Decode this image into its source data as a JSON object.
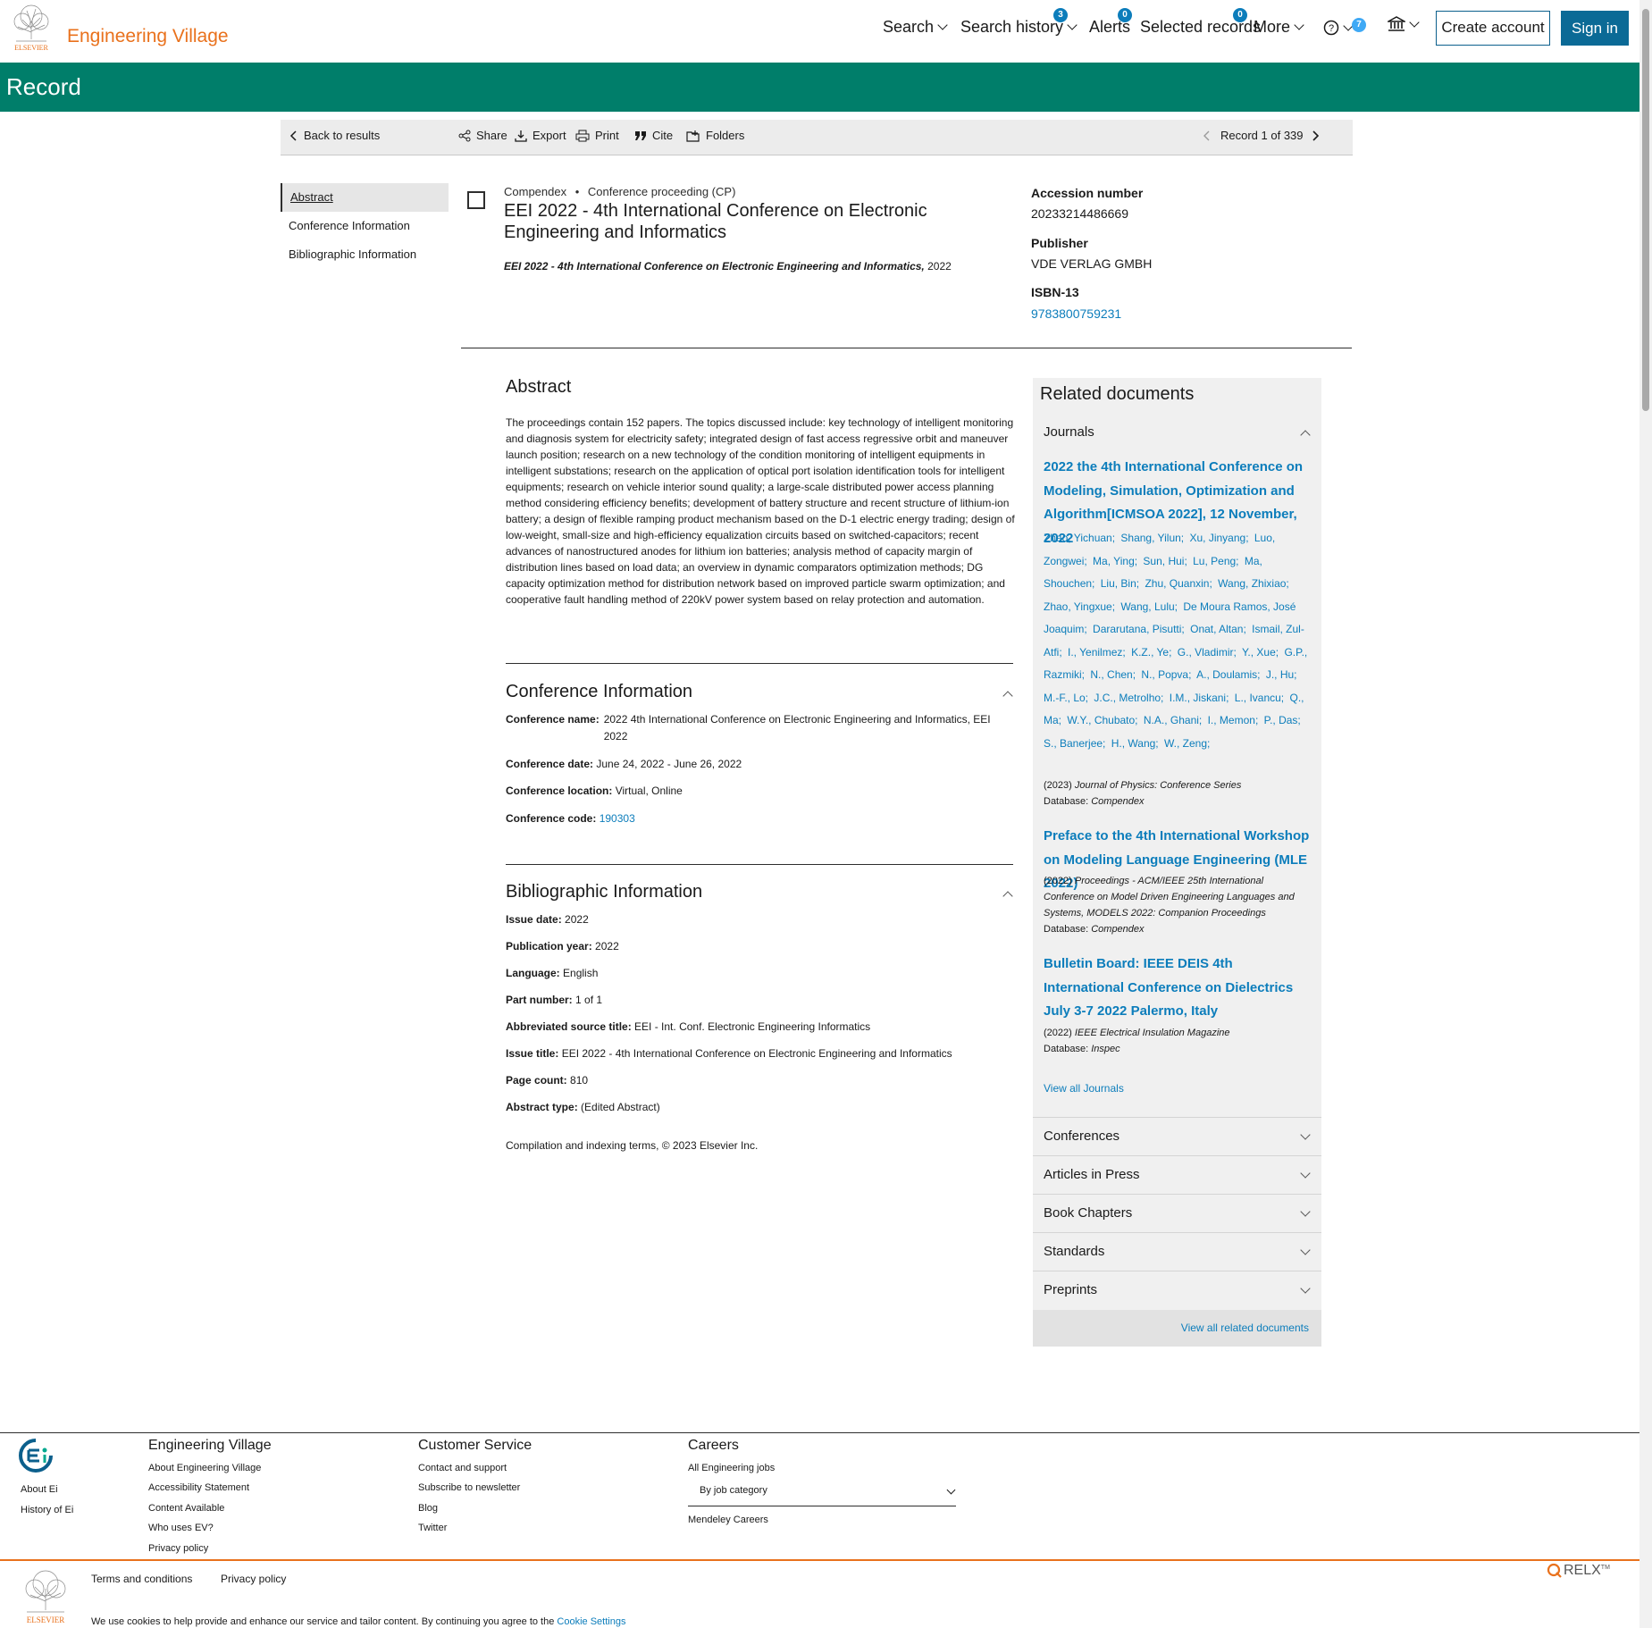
{
  "header": {
    "brand": "Engineering Village",
    "logo_text": "ELSEVIER",
    "nav": {
      "search": "Search",
      "search_history": "Search history",
      "search_history_count": "3",
      "alerts": "Alerts",
      "alerts_count": "0",
      "selected_records": "Selected records",
      "selected_count": "0",
      "more": "More",
      "help_count": "7"
    },
    "create_account": "Create account",
    "sign_in": "Sign in"
  },
  "banner": {
    "title": "Record"
  },
  "toolbar": {
    "back": "Back to results",
    "share": "Share",
    "export": "Export",
    "print": "Print",
    "cite": "Cite",
    "folders": "Folders",
    "record_position": "Record 1 of 339"
  },
  "leftnav": [
    "Abstract",
    "Conference Information",
    "Bibliographic Information"
  ],
  "record": {
    "database": "Compendex",
    "doc_type": "Conference proceeding (CP)",
    "title": "EEI 2022 - 4th International Conference on Electronic Engineering and Informatics",
    "source_title": "EEI 2022 - 4th International Conference on Electronic Engineering and Informatics,",
    "source_year": "2022",
    "accession_label": "Accession number",
    "accession": "20233214486669",
    "publisher_label": "Publisher",
    "publisher": "VDE VERLAG GMBH",
    "isbn_label": "ISBN-13",
    "isbn": "9783800759231"
  },
  "abstract": {
    "heading": "Abstract",
    "text": "The proceedings contain 152 papers. The topics discussed include: key technology of intelligent monitoring and diagnosis system for electricity safety; integrated design of fast access regressive orbit and maneuver launch position; research on a new technology of the condition monitoring of intelligent equipments in intelligent substations; research on the application of optical port isolation identification tools for intelligent equipments; research on vehicle interior sound quality; a large-scale distributed power access planning method considering efficiency benefits; development of battery structure and recent structure of lithium-ion battery; a design of flexible ramping product mechanism based on the D-1 electric energy trading; design of low-weight, small-size and high-efficiency equalization circuits based on switched-capacitors; recent advances of nanostructured anodes for lithium ion batteries; analysis method of capacity margin of distribution lines based on load data; an overview in dynamic comparators optimization methods; DG capacity optimization method for distribution network based on improved particle swarm optimization; and cooperative fault handling method of 220kV power system based on relay protection and automation."
  },
  "conference": {
    "heading": "Conference Information",
    "name_label": "Conference name:",
    "name": "2022 4th International Conference on Electronic Engineering and Informatics, EEI 2022",
    "date_label": "Conference date:",
    "date": "June 24, 2022 - June 26, 2022",
    "location_label": "Conference location:",
    "location": "Virtual, Online",
    "code_label": "Conference code:",
    "code": "190303"
  },
  "bibliographic": {
    "heading": "Bibliographic Information",
    "fields": [
      {
        "label": "Issue date:",
        "value": "2022"
      },
      {
        "label": "Publication year:",
        "value": "2022"
      },
      {
        "label": "Language:",
        "value": "English"
      },
      {
        "label": "Part number:",
        "value": "1 of 1"
      },
      {
        "label": "Abbreviated source title:",
        "value": "EEI - Int. Conf. Electronic Engineering Informatics"
      },
      {
        "label": "Issue title:",
        "value": "EEI 2022 - 4th International Conference on Electronic Engineering and Informatics"
      },
      {
        "label": "Page count:",
        "value": "810"
      },
      {
        "label": "Abstract type:",
        "value": "(Edited Abstract)"
      }
    ],
    "copyright": "Compilation and indexing terms, © 2023 Elsevier Inc."
  },
  "related": {
    "heading": "Related documents",
    "journals_label": "Journals",
    "doc1": {
      "title": "2022 the 4th International Conference on Modeling, Simulation, Optimization and Algorithm[ICMSOA 2022], 12 November, 2022",
      "authors": [
        "Zhao, Yichuan;",
        "Shang, Yilun;",
        "Xu, Jinyang;",
        "Luo, Zongwei;",
        "Ma, Ying;",
        "Sun, Hui;",
        "Lu, Peng;",
        "Ma, Shouchen;",
        "Liu, Bin;",
        "Zhu, Quanxin;",
        "Wang, Zhixiao;",
        "Zhao, Yingxue;",
        "Wang, Lulu;",
        "De Moura Ramos, José Joaquim;",
        "Dararutana, Pisutti;",
        "Onat, Altan;",
        "Ismail, Zul-Atfi;",
        "I., Yenilmez;",
        "K.Z., Ye;",
        "G., Vladimir;",
        "Y., Xue;",
        "G.P., Razmiki;",
        "N., Chen;",
        "N., Popva;",
        "A., Doulamis;",
        "J., Hu;",
        "M.-F., Lo;",
        "J.C., Metrolho;",
        "I.M., Jiskani;",
        "L., Ivancu;",
        "Q., Ma;",
        "W.Y., Chubato;",
        "N.A., Ghani;",
        "I., Memon;",
        "P., Das;",
        "S., Banerjee;",
        "H., Wang;",
        "W., Zeng;"
      ],
      "year": "(2023)",
      "journal": "Journal of Physics: Conference Series",
      "db_label": "Database:",
      "db": "Compendex"
    },
    "doc2": {
      "title": "Preface to the 4th International Workshop on Modeling Language Engineering (MLE 2022)",
      "year": "(2022)",
      "journal": "Proceedings - ACM/IEEE 25th International Conference on Model Driven Engineering Languages and Systems, MODELS 2022: Companion Proceedings",
      "db_label": "Database:",
      "db": "Compendex"
    },
    "doc3": {
      "title": "Bulletin Board: IEEE DEIS 4th International Conference on Dielectrics July 3-7 2022 Palermo, Italy",
      "year": "(2022)",
      "journal": "IEEE Electrical Insulation Magazine",
      "db_label": "Database:",
      "db": "Inspec"
    },
    "view_all_journals": "View all Journals",
    "sections": [
      "Conferences",
      "Articles in Press",
      "Book Chapters",
      "Standards",
      "Preprints"
    ],
    "view_all_related": "View all related documents"
  },
  "footer": {
    "about_ei": "About Ei",
    "history_ei": "History of Ei",
    "col1_heading": "Engineering Village",
    "col1_links": [
      "About Engineering Village",
      "Accessibility Statement",
      "Content Available",
      "Who uses EV?",
      "Privacy policy"
    ],
    "col2_heading": "Customer Service",
    "col2_links": [
      "Contact and support",
      "Subscribe to newsletter",
      "Blog",
      "Twitter"
    ],
    "col3_heading": "Careers",
    "col3_link": "All Engineering jobs",
    "job_select": "By job category",
    "mendeley": "Mendeley Careers",
    "terms": "Terms and conditions",
    "privacy": "Privacy policy",
    "relx": "RELX",
    "tm": "TM",
    "logo_text": "ELSEVIER",
    "cookie_text": "We use cookies to help provide and enhance our service and tailor content. By continuing you agree to the",
    "cookie_link": "Cookie Settings"
  },
  "colors": {
    "accent_green": "#007e6a",
    "brand_orange": "#e9711c",
    "link_blue": "#0c7dbb",
    "button_blue": "#0b6a96"
  }
}
